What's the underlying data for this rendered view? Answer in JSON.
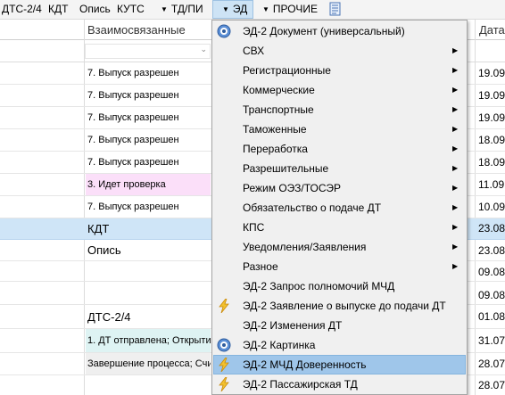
{
  "toolbar": {
    "items": [
      "ДТС-2/4",
      "КДТ",
      "Опись",
      "КУТС"
    ],
    "tdpi": "ТД/ПИ",
    "ed": "ЭД",
    "other": "ПРОЧИЕ"
  },
  "table": {
    "columns": [
      "Взаимосвязанные",
      "Дата"
    ],
    "rows": [
      {
        "status": "7. Выпуск разрешен",
        "date": "19.09"
      },
      {
        "status": "7. Выпуск разрешен",
        "date": "19.09"
      },
      {
        "status": "7. Выпуск разрешен",
        "date": "19.09"
      },
      {
        "status": "7. Выпуск разрешен",
        "date": "18.09"
      },
      {
        "status": "7. Выпуск разрешен",
        "date": "18.09"
      },
      {
        "status": "3. Идет проверка",
        "date": "11.09"
      },
      {
        "status": "7. Выпуск разрешен",
        "date": "10.09"
      },
      {
        "status": "КДТ",
        "date": "23.08"
      },
      {
        "status": "Опись",
        "date": "23.08"
      },
      {
        "status": "",
        "date": "09.08"
      },
      {
        "status": "",
        "date": "09.08"
      },
      {
        "status": "ДТС-2/4",
        "date": "01.08"
      },
      {
        "status": "1. ДТ отправлена; Открыти",
        "date": "31.07"
      },
      {
        "status": "Завершение процесса; Счи",
        "date": "28.07"
      },
      {
        "status": "",
        "date": "28.07"
      }
    ]
  },
  "menu": {
    "items": [
      {
        "label": "ЭД-2 Документ (универсальный)",
        "icon": "target-icon",
        "submenu": false
      },
      {
        "label": "СВХ",
        "submenu": true
      },
      {
        "label": "Регистрационные",
        "submenu": true
      },
      {
        "label": "Коммерческие",
        "submenu": true
      },
      {
        "label": "Транспортные",
        "submenu": true
      },
      {
        "label": "Таможенные",
        "submenu": true
      },
      {
        "label": "Переработка",
        "submenu": true
      },
      {
        "label": "Разрешительные",
        "submenu": true
      },
      {
        "label": "Режим ОЭЗ/ТОСЭР",
        "submenu": true
      },
      {
        "label": "Обязательство о подаче ДТ",
        "submenu": true
      },
      {
        "label": "КПС",
        "submenu": true
      },
      {
        "label": "Уведомления/Заявления",
        "submenu": true
      },
      {
        "label": "Разное",
        "submenu": true
      },
      {
        "label": "ЭД-2 Запрос полномочий МЧД",
        "submenu": false
      },
      {
        "label": "ЭД-2 Заявление о выпуске до подачи ДТ",
        "icon": "lightning-icon",
        "submenu": false
      },
      {
        "label": "ЭД-2 Изменения ДТ",
        "submenu": false
      },
      {
        "label": "ЭД-2 Картинка",
        "icon": "target-icon",
        "submenu": false
      },
      {
        "label": "ЭД-2 МЧД Доверенность",
        "icon": "lightning-icon",
        "submenu": false,
        "active": true
      },
      {
        "label": "ЭД-2 Пассажирская ТД",
        "icon": "lightning-icon",
        "submenu": false
      }
    ]
  },
  "colors": {
    "highlight_row": "#cfe5f7",
    "menu_hover": "#9fc6ea",
    "status_pink": "#fbdff9",
    "status_teal": "#def3f3"
  }
}
